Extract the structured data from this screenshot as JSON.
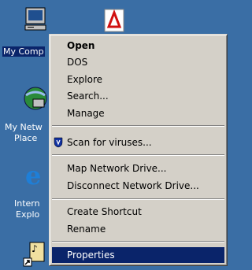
{
  "desktop": {
    "icons": [
      {
        "label": "My Comp",
        "icon": "my-computer-icon"
      },
      {
        "label": "My Netw",
        "label2": "Place",
        "icon": "network-places-icon"
      },
      {
        "label": "Intern",
        "label2": "Explo",
        "icon": "internet-explorer-icon"
      },
      {
        "label": "",
        "icon": "acrobat-shortcut-icon"
      },
      {
        "label": "",
        "icon": "media-shortcut-icon"
      }
    ]
  },
  "context_menu": {
    "items": [
      {
        "label": "Open",
        "bold": true
      },
      {
        "label": "DOS"
      },
      {
        "label": "Explore"
      },
      {
        "label": "Search..."
      },
      {
        "label": "Manage"
      },
      {
        "label": "Scan for viruses...",
        "icon": "shield-icon"
      },
      {
        "label": "Map Network Drive..."
      },
      {
        "label": "Disconnect Network Drive..."
      },
      {
        "label": "Create Shortcut"
      },
      {
        "label": "Rename"
      },
      {
        "label": "Properties",
        "highlighted": true
      }
    ]
  },
  "colors": {
    "desktop": "#3a6ea5",
    "menu_bg": "#d4d0c8",
    "highlight": "#0a246a"
  }
}
